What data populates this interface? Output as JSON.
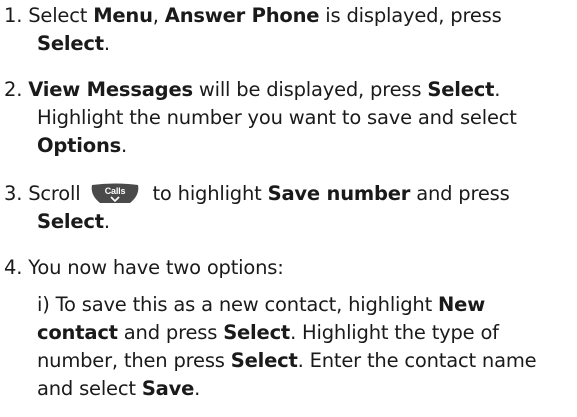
{
  "steps": [
    {
      "num": "1.",
      "lines": [
        [
          {
            "t": "Select ",
            "b": false
          },
          {
            "t": "Menu",
            "b": true
          },
          {
            "t": ", ",
            "b": false
          },
          {
            "t": "Answer Phone",
            "b": true
          },
          {
            "t": " is displayed, press",
            "b": false
          }
        ],
        [
          {
            "t": "Select",
            "b": true
          },
          {
            "t": ".",
            "b": false
          }
        ]
      ]
    },
    {
      "num": "2.",
      "lines": [
        [
          {
            "t": "View Messages",
            "b": true
          },
          {
            "t": " will be displayed, press ",
            "b": false
          },
          {
            "t": "Select",
            "b": true
          },
          {
            "t": ".",
            "b": false
          }
        ],
        [
          {
            "t": "Highlight the number you want to save and select",
            "b": false
          }
        ],
        [
          {
            "t": "Options",
            "b": true
          },
          {
            "t": ".",
            "b": false
          }
        ]
      ]
    },
    {
      "num": "3.",
      "lines": [
        [
          {
            "t": "Scroll ",
            "b": false
          },
          {
            "icon": "calls-key-icon",
            "label": "Calls"
          },
          {
            "t": " to highlight ",
            "b": false
          },
          {
            "t": "Save number",
            "b": true
          },
          {
            "t": " and press",
            "b": false
          }
        ],
        [
          {
            "t": "Select",
            "b": true
          },
          {
            "t": ".",
            "b": false
          }
        ]
      ]
    },
    {
      "num": "4.",
      "lines": [
        [
          {
            "t": "You now have two options:",
            "b": false
          }
        ]
      ],
      "sub_lines": [
        [
          {
            "t": "i) To save this as a new contact, highlight ",
            "b": false
          },
          {
            "t": "New",
            "b": true
          }
        ],
        [
          {
            "t": "contact",
            "b": true
          },
          {
            "t": " and press ",
            "b": false
          },
          {
            "t": "Select",
            "b": true
          },
          {
            "t": ". Highlight the type of",
            "b": false
          }
        ],
        [
          {
            "t": "number, then press ",
            "b": false
          },
          {
            "t": "Select",
            "b": true
          },
          {
            "t": ". Enter the contact name",
            "b": false
          }
        ],
        [
          {
            "t": "and select ",
            "b": false
          },
          {
            "t": "Save",
            "b": true
          },
          {
            "t": ".",
            "b": false
          }
        ]
      ]
    }
  ],
  "colors": {
    "text": "#1a1a1a",
    "key_fill": "#4a4a4a",
    "key_text": "#ffffff"
  }
}
